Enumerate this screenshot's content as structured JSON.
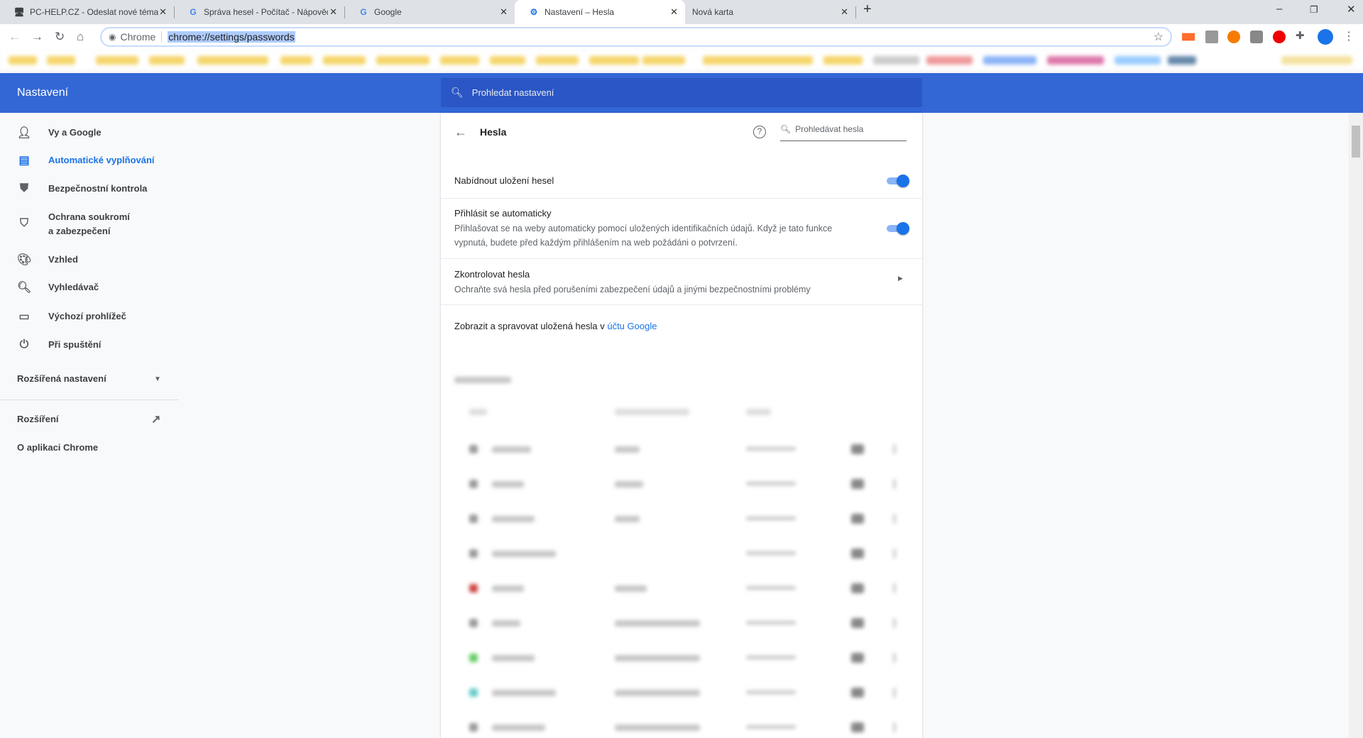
{
  "browser": {
    "tabs": [
      {
        "title": "PC-HELP.CZ - Odeslat nové téma",
        "icon": "computer-icon",
        "active": false
      },
      {
        "title": "Správa hesel - Počítač - Nápověd",
        "icon": "google-icon",
        "active": false
      },
      {
        "title": "Google",
        "icon": "google-icon",
        "active": false
      },
      {
        "title": "Nastavení – Hesla",
        "icon": "gear-icon",
        "active": true
      },
      {
        "title": "Nová karta",
        "icon": "",
        "active": false
      }
    ],
    "omnibox": {
      "chip": "Chrome",
      "url": "chrome://settings/passwords"
    }
  },
  "header": {
    "title": "Nastavení",
    "search_placeholder": "Prohledat nastavení"
  },
  "sidebar": {
    "items": [
      {
        "label": "Vy a Google",
        "icon": "person-icon"
      },
      {
        "label": "Automatické vyplňování",
        "icon": "clipboard-icon",
        "selected": true
      },
      {
        "label": "Bezpečnostní kontrola",
        "icon": "shield-check-icon"
      },
      {
        "label": "Ochrana soukromí a zabezpečení",
        "line1": "Ochrana soukromí",
        "line2": "a zabezpečení",
        "icon": "shield-icon"
      },
      {
        "label": "Vzhled",
        "icon": "palette-icon"
      },
      {
        "label": "Vyhledávač",
        "icon": "search-icon"
      },
      {
        "label": "Výchozí prohlížeč",
        "icon": "browser-icon"
      },
      {
        "label": "Při spuštění",
        "icon": "power-icon"
      }
    ],
    "advanced": "Rozšířená nastavení",
    "extensions": "Rozšíření",
    "about": "O aplikaci Chrome"
  },
  "passwords": {
    "title": "Hesla",
    "search_placeholder": "Prohledávat hesla",
    "offer_save": {
      "label": "Nabídnout uložení hesel",
      "enabled": true
    },
    "auto_signin": {
      "label": "Přihlásit se automaticky",
      "desc_line1": "Přihlašovat se na weby automaticky pomocí uložených identifikačních údajů. Když je tato funkce",
      "desc_line2": "vypnutá, budete před každým přihlášením na web požádáni o potvrzení.",
      "enabled": true
    },
    "check": {
      "label": "Zkontrolovat hesla",
      "desc": "Ochraňte svá hesla před porušeními zabezpečení údajů a jinými bezpečnostními problémy"
    },
    "manage": {
      "text": "Zobrazit a spravovat uložená hesla v ",
      "link": "účtu Google"
    }
  },
  "colors": {
    "accent": "#1a73e8",
    "header": "#3367d6",
    "header_search": "#2a56c6"
  }
}
